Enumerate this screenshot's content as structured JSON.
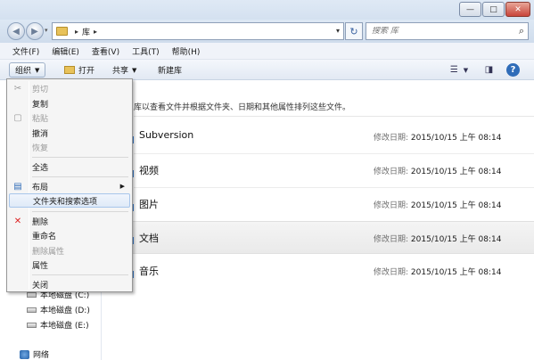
{
  "window": {
    "minimize": "—",
    "maximize": "□",
    "close": "✕"
  },
  "address": {
    "crumb": "库",
    "search_placeholder": "搜索 库"
  },
  "menubar": {
    "items": [
      "文件(F)",
      "编辑(E)",
      "查看(V)",
      "工具(T)",
      "帮助(H)"
    ]
  },
  "toolbar": {
    "organize": "组织",
    "open": "打开",
    "share": "共享",
    "new_library": "新建库"
  },
  "dropdown": {
    "items": [
      {
        "label": "剪切",
        "disabled": true
      },
      {
        "label": "复制",
        "disabled": false
      },
      {
        "label": "粘贴",
        "disabled": true
      },
      {
        "label": "撤消",
        "disabled": false
      },
      {
        "label": "恢复",
        "disabled": true
      },
      {
        "label": "全选",
        "disabled": false
      },
      {
        "label": "布局",
        "disabled": false,
        "submenu": true
      },
      {
        "label": "文件夹和搜索选项",
        "disabled": false,
        "highlighted": true
      },
      {
        "label": "删除",
        "disabled": false
      },
      {
        "label": "重命名",
        "disabled": false
      },
      {
        "label": "删除属性",
        "disabled": true
      },
      {
        "label": "属性",
        "disabled": false
      },
      {
        "label": "关闭",
        "disabled": false
      }
    ]
  },
  "content": {
    "hint": "库以查看文件并根据文件夹、日期和其他属性排列这些文件。",
    "libraries": [
      {
        "name": "Subversion",
        "date_label": "修改日期:",
        "date_value": "2015/10/15 上午 08:14"
      },
      {
        "name": "视频",
        "date_label": "修改日期:",
        "date_value": "2015/10/15 上午 08:14"
      },
      {
        "name": "图片",
        "date_label": "修改日期:",
        "date_value": "2015/10/15 上午 08:14"
      },
      {
        "name": "文档",
        "date_label": "修改日期:",
        "date_value": "2015/10/15 上午 08:14",
        "selected": true
      },
      {
        "name": "音乐",
        "date_label": "修改日期:",
        "date_value": "2015/10/15 上午 08:14"
      }
    ]
  },
  "navpane": {
    "drives": [
      "本地磁盘 (C:)",
      "本地磁盘 (D:)",
      "本地磁盘 (E:)"
    ],
    "network": "网络"
  }
}
